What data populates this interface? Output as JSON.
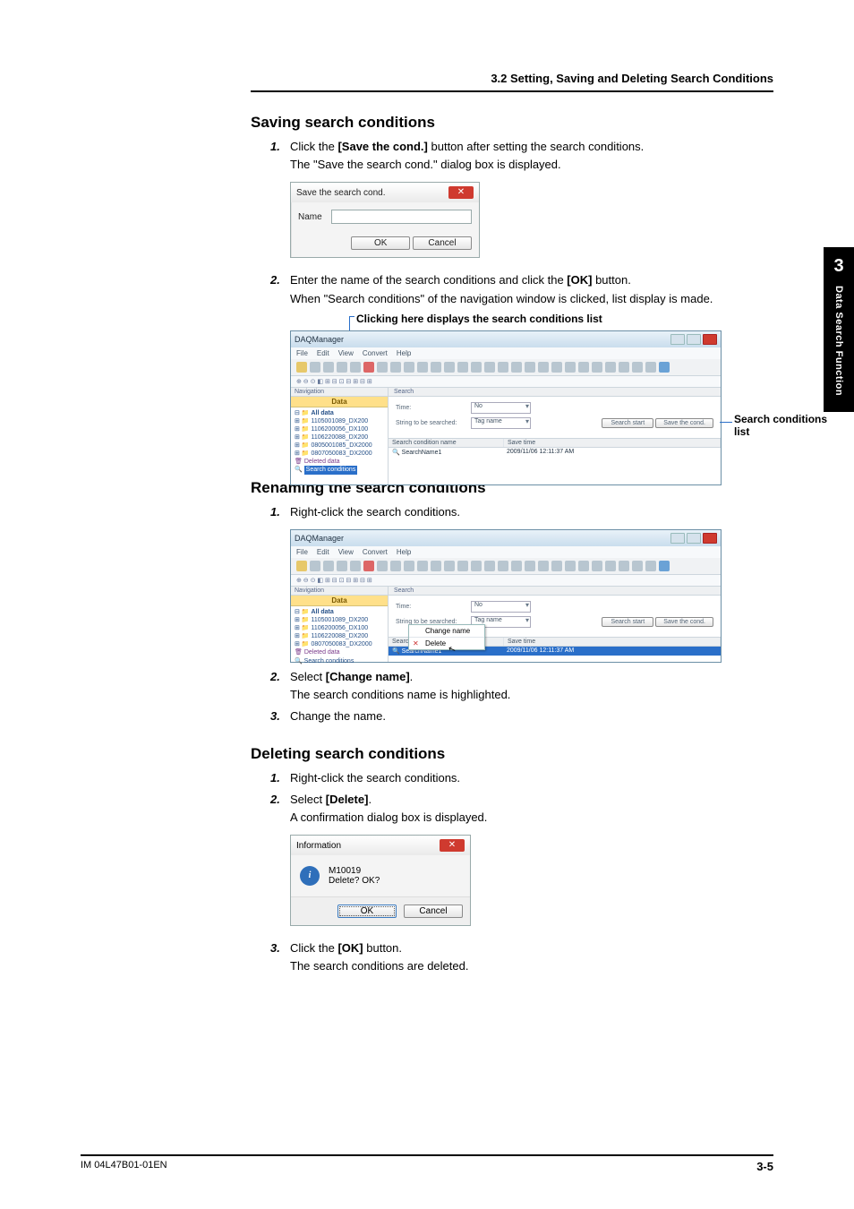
{
  "breadcrumb": "3.2  Setting, Saving and Deleting Search Conditions",
  "sideTab": {
    "chapter": "3",
    "label": "Data Search Function"
  },
  "footer": {
    "doc": "IM 04L47B01-01EN",
    "page": "3-5"
  },
  "sec1": {
    "heading": "Saving search conditions",
    "s1a": "Click the ",
    "s1b": "[Save the cond.]",
    "s1c": " button after setting the search conditions.",
    "s1d": "The \"Save the search cond.\" dialog box is displayed.",
    "dlg": {
      "title": "Save the search cond.",
      "nameLabel": "Name",
      "ok": "OK",
      "cancel": "Cancel"
    },
    "s2a": "Enter the name of the search conditions and click the ",
    "s2b": "[OK]",
    "s2c": " button.",
    "s2d": "When \"Search conditions\" of the navigation window is clicked, list display is made.",
    "figTop": "Clicking here displays the search conditions list",
    "figRight": "Search conditions list"
  },
  "app": {
    "title": "DAQManager",
    "menu": [
      "File",
      "Edit",
      "View",
      "Convert",
      "Help"
    ],
    "navHeader": "Navigation",
    "dataHeader": "Data",
    "tree": [
      "All data",
      "1105001089_DX200",
      "1106200056_DX100",
      "1106220088_DX200",
      "0805001085_DX2000",
      "0807050083_DX2000",
      "Deleted data",
      "Search conditions"
    ],
    "mainHeader": "Search",
    "form": {
      "timeLabel": "Time:",
      "timeVal": "No",
      "strLabel": "String to be searched:",
      "strVal": "Tag name",
      "btnStart": "Search start",
      "btnSave": "Save the cond."
    },
    "tbl": {
      "c1": "Search condition name",
      "c2": "Save time",
      "r1c1": "SearchName1",
      "r1c2": "2009/11/06 12:11:37 AM"
    },
    "ctx": {
      "change": "Change name",
      "del": "Delete"
    }
  },
  "sec2": {
    "heading": "Renaming the search conditions",
    "s1": "Right-click the search conditions.",
    "s2a": "Select ",
    "s2b": "[Change name]",
    "s2c": ".",
    "s2d": "The search conditions name is highlighted.",
    "s3": "Change the name."
  },
  "sec3": {
    "heading": "Deleting search conditions",
    "s1": "Right-click the search conditions.",
    "s2a": "Select ",
    "s2b": "[Delete]",
    "s2c": ".",
    "s2d": "A confirmation dialog box is displayed.",
    "info": {
      "title": "Information",
      "line1": "M10019",
      "line2": "Delete? OK?",
      "ok": "OK",
      "cancel": "Cancel"
    },
    "s3a": "Click the ",
    "s3b": "[OK]",
    "s3c": " button.",
    "s3d": "The search conditions are deleted."
  }
}
